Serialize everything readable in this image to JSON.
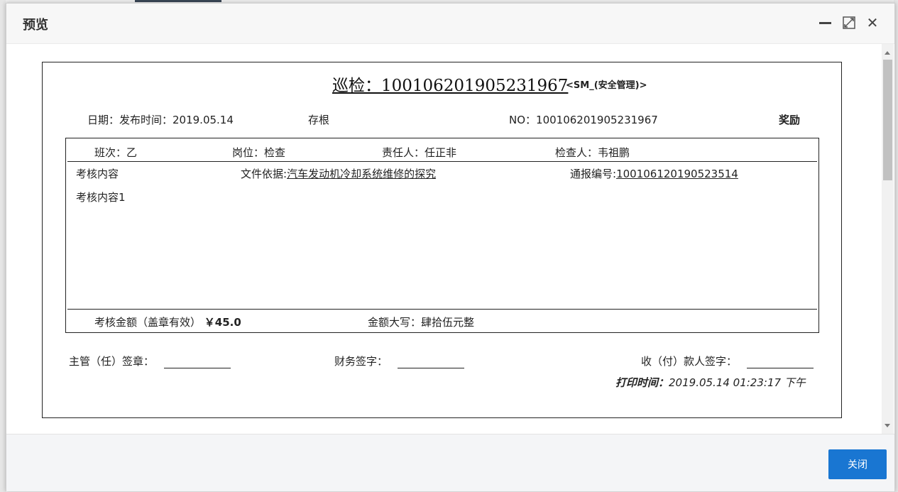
{
  "dialog": {
    "title": "预览",
    "icons": {
      "minimize": "minimize-icon",
      "maximize": "maximize-icon",
      "close": "close-icon"
    }
  },
  "document": {
    "title": "巡检：100106201905231967",
    "subtitle": "<SM_(安全管理)>",
    "date_label": "日期：发布时间：2019.05.14",
    "stub_label": "存根",
    "number_label": "NO：100106201905231967",
    "type_label": "奖励",
    "shift_label": "班次：乙",
    "post_label": "岗位：检查",
    "responsible_label": "责任人：任正非",
    "inspector_label": "检查人：韦祖鹏",
    "assessment_header": "考核内容",
    "basis_prefix": "文件依据:",
    "basis_value": "汽车发动机冷却系统维修的探究",
    "report_prefix": "通报编号:",
    "report_value": "100106120190523514",
    "assessment_content": "考核内容1",
    "amount_label": "考核金额（盖章有效）",
    "amount_value": "￥45.0",
    "amount_words": "金额大写：肆拾伍元整",
    "supervisor_sign": "主管（任）签章：",
    "finance_sign": "财务签字：",
    "payee_sign": "收（付）款人签字：",
    "print_time_label": "打印时间：",
    "print_time_value": "2019.05.14 01:23:17 下午"
  },
  "footer": {
    "close_label": "关闭"
  },
  "colors": {
    "primary": "#1976d2",
    "header_bg": "#f7f7f7",
    "footer_bg": "#f4f5f7"
  }
}
